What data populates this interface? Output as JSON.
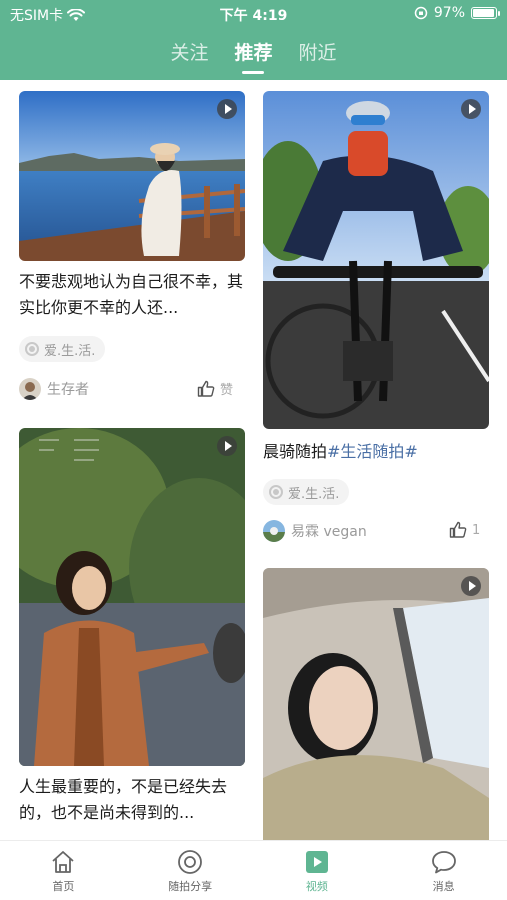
{
  "status_bar": {
    "carrier": "无SIM卡",
    "time": "下午 4:19",
    "battery": "97%",
    "battery_level": 0.97
  },
  "top_tabs": [
    {
      "label": "关注",
      "active": false
    },
    {
      "label": "推荐",
      "active": true
    },
    {
      "label": "附近",
      "active": false
    }
  ],
  "feed": {
    "card1": {
      "title": "不要悲观地认为自己很不幸，其实比你更不幸的人还...",
      "tag": "爱.生.活.",
      "user": "生存者",
      "like_label": "赞"
    },
    "card2": {
      "title": "晨骑随拍",
      "hashtag": "#生活随拍#",
      "tag": "爱.生.活.",
      "user": "易霖 vegan",
      "like_count": "1"
    },
    "card3": {
      "title": "人生最重要的，不是已经失去的，也不是尚未得到的..."
    },
    "card4": {}
  },
  "bottom_nav": [
    {
      "label": "首页",
      "icon": "home-icon",
      "active": false
    },
    {
      "label": "随拍分享",
      "icon": "camera-icon",
      "active": false
    },
    {
      "label": "视频",
      "icon": "video-icon",
      "active": true
    },
    {
      "label": "消息",
      "icon": "message-icon",
      "active": false
    }
  ],
  "colors": {
    "brand": "#5fb592",
    "hashtag": "#4a6fa5"
  }
}
